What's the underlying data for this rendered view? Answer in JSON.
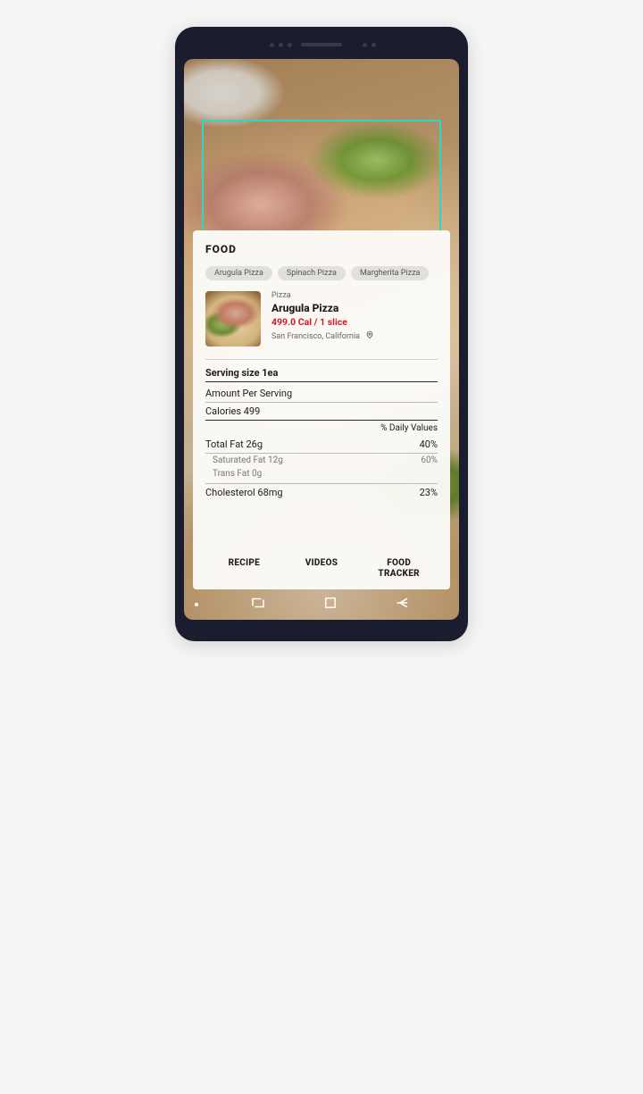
{
  "card": {
    "title": "FOOD",
    "chips": [
      "Arugula Pizza",
      "Spinach Pizza",
      "Margherita Pizza"
    ],
    "item": {
      "category": "Pizza",
      "name": "Arugula Pizza",
      "cal_line": "499.0 Cal / 1 slice",
      "location": "San Francisco, California"
    },
    "nutrition": {
      "serving_size": "Serving size 1ea",
      "amount_per": "Amount Per Serving",
      "calories": "Calories 499",
      "daily_values_label": "% Daily Values",
      "total_fat": {
        "label": "Total Fat 26g",
        "pct": "40%"
      },
      "sat_fat": {
        "label": "Saturated Fat 12g",
        "pct": "60%"
      },
      "trans_fat": {
        "label": "Trans Fat 0g",
        "pct": ""
      },
      "cholesterol": {
        "label": "Cholesterol 68mg",
        "pct": "23%"
      }
    },
    "actions": {
      "recipe": "RECIPE",
      "videos": "VIDEOS",
      "food_tracker_l1": "FOOD",
      "food_tracker_l2": "TRACKER"
    }
  }
}
